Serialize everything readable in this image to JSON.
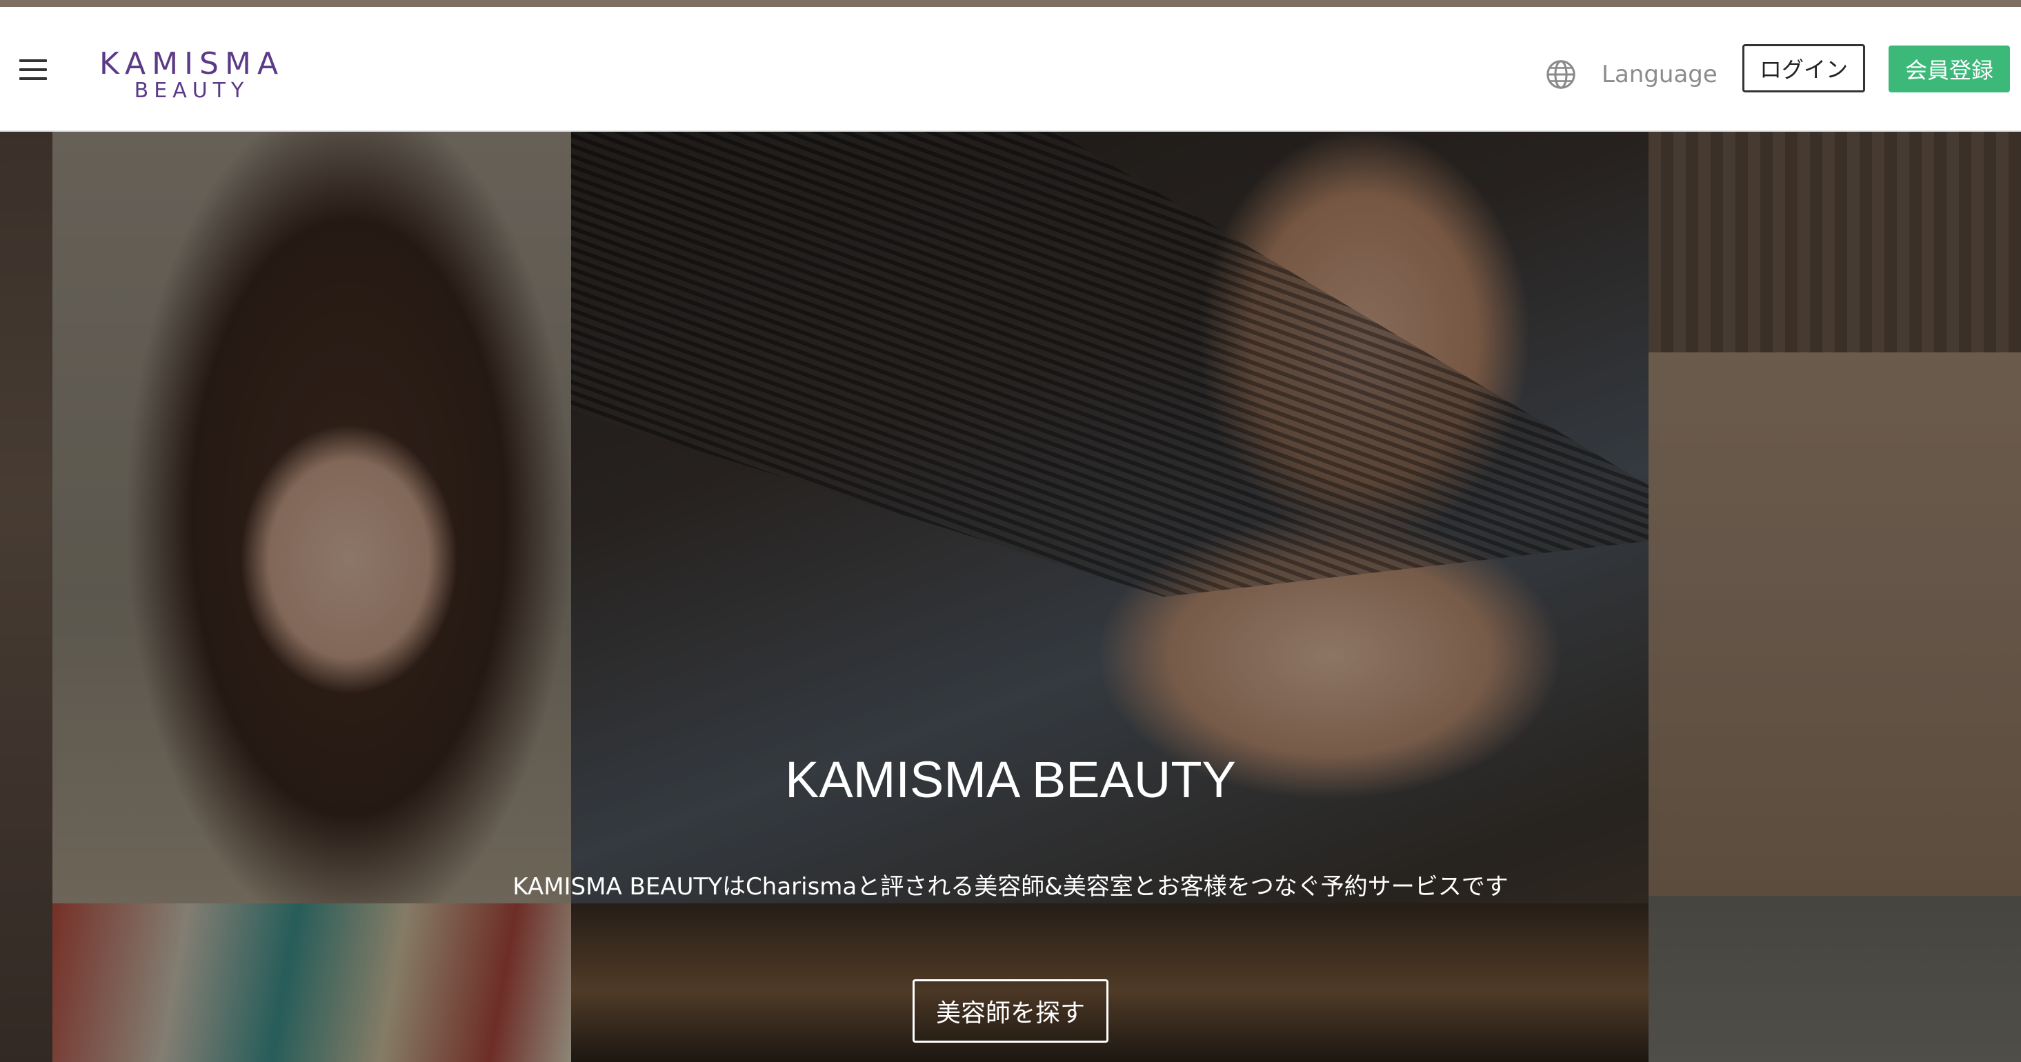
{
  "header": {
    "logo": {
      "main": "KAMISMA",
      "sub": "BEAUTY"
    },
    "language_label": "Language",
    "login_label": "ログイン",
    "register_label": "会員登録"
  },
  "hero": {
    "title": "KAMISMA BEAUTY",
    "subtitle": "KAMISMA BEAUTYはCharismaと評される美容師&美容室とお客様をつなぐ予約サービスです",
    "cta_label": "美容師を探す"
  },
  "colors": {
    "brand_purple": "#5b3b87",
    "register_green": "#3cb878",
    "top_stripe": "#7d7063"
  },
  "icons": [
    "menu-icon",
    "globe-icon"
  ]
}
